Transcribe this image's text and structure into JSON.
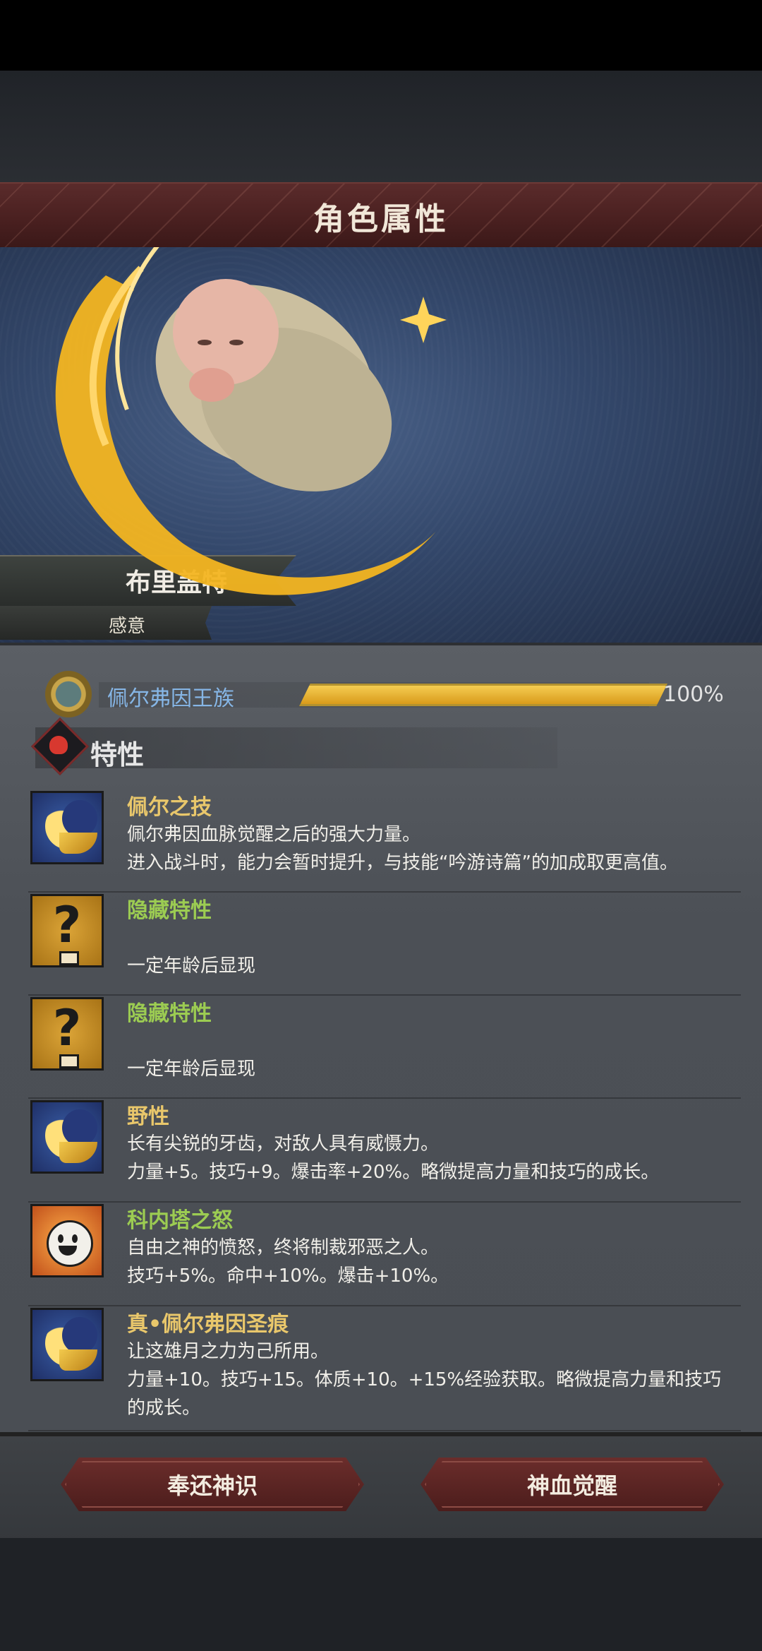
{
  "header": {
    "title": "角色属性"
  },
  "character": {
    "name": "布里盖特",
    "subtitle": "感意"
  },
  "bloodline": {
    "name": "佩尔弗因王族",
    "progress_percent": 100,
    "progress_label": "100%"
  },
  "traits_section": {
    "title": "特性"
  },
  "traits": [
    {
      "icon": "moon-icon",
      "name": "佩尔之技",
      "name_color": "#e9c76b",
      "desc": [
        "佩尔弗因血脉觉醒之后的强大力量。",
        "进入战斗时，能力会暂时提升，与技能“吟游诗篇”的加成取更高值。"
      ]
    },
    {
      "icon": "question-icon",
      "name": "隐藏特性",
      "name_color": "#9ccc52",
      "desc": [
        "",
        "一定年龄后显现"
      ]
    },
    {
      "icon": "question-icon",
      "name": "隐藏特性",
      "name_color": "#9ccc52",
      "desc": [
        "",
        "一定年龄后显现"
      ]
    },
    {
      "icon": "moon-icon",
      "name": "野性",
      "name_color": "#e9c76b",
      "desc": [
        "长有尖锐的牙齿，对敌人具有威慑力。",
        "力量+5。技巧+9。爆击率+20%。略微提高力量和技巧的成长。"
      ]
    },
    {
      "icon": "sun-face-icon",
      "name": "科内塔之怒",
      "name_color": "#9ccc52",
      "desc": [
        "自由之神的愤怒，终将制裁邪恶之人。",
        "技巧+5%。命中+10%。爆击+10%。"
      ]
    },
    {
      "icon": "moon-icon",
      "name": "真•佩尔弗因圣痕",
      "name_color": "#e9c76b",
      "desc": [
        "让这雄月之力为己所用。",
        "力量+10。技巧+15。体质+10。+15%经验获取。略微提高力量和技巧的成长。"
      ]
    }
  ],
  "buttons": {
    "left": "奉还神识",
    "right": "神血觉醒"
  }
}
